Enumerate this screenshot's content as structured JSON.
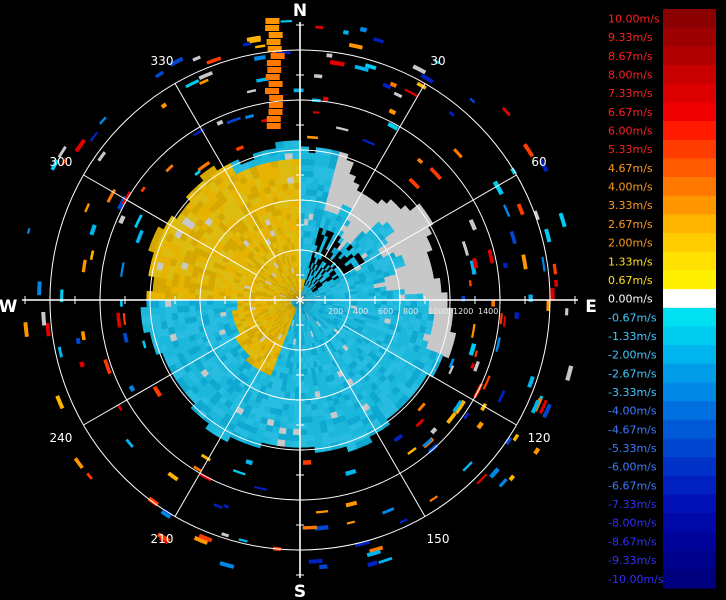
{
  "chart_data": {
    "type": "heatmap",
    "title": "",
    "projection": "polar",
    "cardinal_labels": [
      "N",
      "E",
      "S",
      "W"
    ],
    "azimuth_labels": [
      "30",
      "60",
      "120",
      "150",
      "210",
      "240",
      "300",
      "330"
    ],
    "range_labels": [
      "200",
      "400",
      "600",
      "800",
      "1000",
      "1200",
      "1400"
    ],
    "colorbar": {
      "unit": "m/s",
      "labels": [
        "10.00m/s",
        "9.33m/s",
        "8.67m/s",
        "8.00m/s",
        "7.33m/s",
        "6.67m/s",
        "6.00m/s",
        "5.33m/s",
        "4.67m/s",
        "4.00m/s",
        "3.33m/s",
        "2.67m/s",
        "2.00m/s",
        "1.33m/s",
        "0.67m/s",
        "0.00m/s",
        "-0.67m/s",
        "-1.33m/s",
        "-2.00m/s",
        "-2.67m/s",
        "-3.33m/s",
        "-4.00m/s",
        "-4.67m/s",
        "-5.33m/s",
        "-6.00m/s",
        "-6.67m/s",
        "-7.33m/s",
        "-8.00m/s",
        "-8.67m/s",
        "-9.33m/s",
        "-10.00m/s"
      ],
      "colors": [
        "#8b0000",
        "#9c0000",
        "#b00000",
        "#c80000",
        "#dc0000",
        "#ee0000",
        "#ff1a00",
        "#ff3c00",
        "#ff5a00",
        "#ff7800",
        "#ff9600",
        "#ffb400",
        "#ffcc00",
        "#ffe000",
        "#fff000",
        "#ffffff",
        "#00e0f0",
        "#00ccf0",
        "#00b4ee",
        "#009ce8",
        "#0088e6",
        "#0070e0",
        "#005ad8",
        "#0046d0",
        "#0032c8",
        "#0020c0",
        "#0010b4",
        "#0008a8",
        "#00049a",
        "#00028c",
        "#00007e"
      ],
      "label_colors": {
        "positive_high": "#ff2020",
        "positive_mid": "#ff9a1e",
        "positive_low": "#ffe020",
        "zero": "#ffffff",
        "negative_light": "#40c8ff",
        "negative_mid": "#3c7cff",
        "negative_deep": "#3030ff"
      }
    },
    "echo_colors": {
      "receding": "#e8b800",
      "approaching": "#18b8d8",
      "noise": "#c8c8c8"
    },
    "series": [
      {
        "radial_velocity_ms": 1.5,
        "azimuth_deg": [
          270,
          360
        ],
        "range_m": [
          0,
          1000
        ]
      },
      {
        "radial_velocity_ms": -2.0,
        "azimuth_deg": [
          0,
          270
        ],
        "range_m": [
          0,
          1000
        ]
      }
    ]
  }
}
